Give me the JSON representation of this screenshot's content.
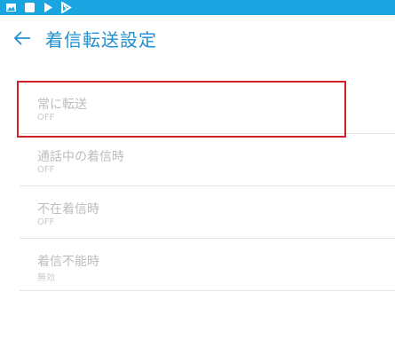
{
  "status_bar": {
    "icons": [
      "image-icon",
      "square-icon",
      "play-store-icon",
      "play-movies-icon"
    ],
    "color": "#1ba5e0"
  },
  "app_bar": {
    "back_icon": "arrow-left-icon",
    "title": "着信転送設定",
    "title_color": "#1f8fd0"
  },
  "items": [
    {
      "title": "常に転送",
      "value": "OFF"
    },
    {
      "title": "通話中の着信時",
      "value": "OFF"
    },
    {
      "title": "不在着信時",
      "value": "OFF"
    },
    {
      "title": "着信不能時",
      "value": "無効"
    }
  ],
  "highlight_color": "#d0202a"
}
